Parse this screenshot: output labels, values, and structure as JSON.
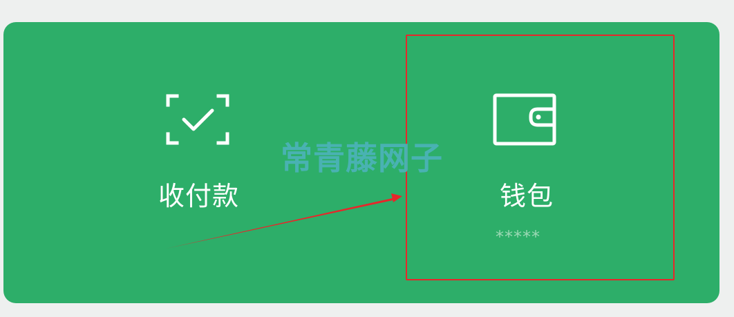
{
  "pay_tile": {
    "label": "收付款",
    "icon": "scan-check-icon"
  },
  "wallet_tile": {
    "label": "钱包",
    "balance_masked": "*****",
    "icon": "wallet-icon"
  },
  "watermark": {
    "text": "常青藤网子"
  },
  "annotation": {
    "highlight_color": "#e8262a",
    "arrow_color": "#e8262a"
  },
  "colors": {
    "card_background": "#2dae69",
    "page_background": "#eef0ef",
    "label_text": "#ffffff",
    "balance_text": "#9cd9b5"
  }
}
